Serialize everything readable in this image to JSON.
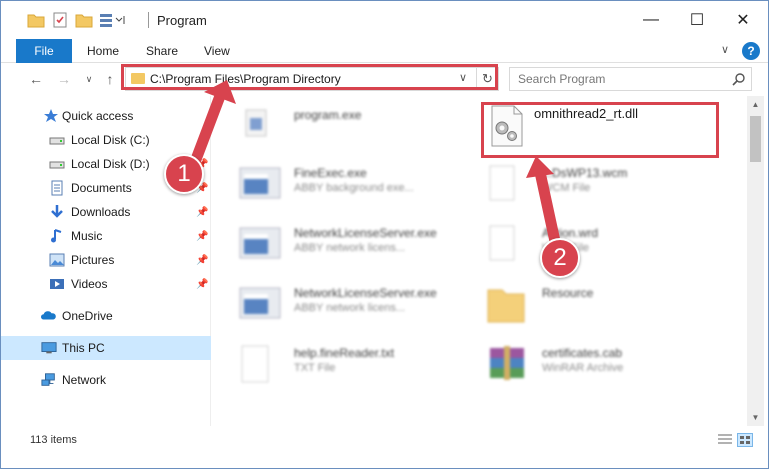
{
  "window": {
    "title": "Program",
    "controls": {
      "minimize": "—",
      "maximize": "☐",
      "close": "✕"
    }
  },
  "ribbon": {
    "tabs": [
      "File",
      "Home",
      "Share",
      "View"
    ],
    "help": "?"
  },
  "address": {
    "path": "C:\\Program Files\\Program Directory",
    "search_placeholder": "Search Program"
  },
  "nav_pane": {
    "items": [
      {
        "label": "Quick access",
        "icon": "star-icon",
        "pinned": false
      },
      {
        "label": "Local Disk (C:)",
        "icon": "drive-icon",
        "pinned": false
      },
      {
        "label": "Local Disk (D:)",
        "icon": "drive-icon",
        "pinned": true
      },
      {
        "label": "Documents",
        "icon": "documents-icon",
        "pinned": true
      },
      {
        "label": "Downloads",
        "icon": "downloads-icon",
        "pinned": true
      },
      {
        "label": "Music",
        "icon": "music-icon",
        "pinned": true
      },
      {
        "label": "Pictures",
        "icon": "pictures-icon",
        "pinned": true
      },
      {
        "label": "Videos",
        "icon": "videos-icon",
        "pinned": true
      },
      {
        "label": "OneDrive",
        "icon": "onedrive-icon",
        "pinned": false
      },
      {
        "label": "This PC",
        "icon": "this-pc-icon",
        "pinned": false,
        "selected": true
      },
      {
        "label": "Network",
        "icon": "network-icon",
        "pinned": false
      }
    ]
  },
  "files": {
    "left": [
      {
        "name": "program.exe",
        "desc": "",
        "icon": "program-exe-icon"
      },
      {
        "name": "FineExec.exe",
        "desc": "ABBY background exe...",
        "icon": "app-icon"
      },
      {
        "name": "NetworkLicenseServer.exe",
        "desc": "ABBY network licens...",
        "icon": "app-icon"
      },
      {
        "name": "NetworkLicenseServer.exe",
        "desc": "ABBY network licens...",
        "icon": "app-icon"
      },
      {
        "name": "help.fineReader.txt",
        "desc": "TXT File",
        "icon": "text-file-icon"
      }
    ],
    "right": [
      {
        "name": "omnithread2_rt.dll",
        "desc": "",
        "icon": "dll-gear-icon",
        "highlighted": true
      },
      {
        "name": "...DsWP13.wcm",
        "desc": "WCM File",
        "icon": "blank-file-icon"
      },
      {
        "name": "Action.wrd",
        "desc": "WRD File",
        "icon": "blank-file-icon"
      },
      {
        "name": "Resource",
        "desc": "",
        "icon": "folder-icon"
      },
      {
        "name": "certificates.cab",
        "desc": "WinRAR Archive",
        "icon": "winrar-icon"
      }
    ]
  },
  "status": {
    "item_count": "113 items"
  },
  "callouts": {
    "one": "1",
    "two": "2"
  },
  "colors": {
    "accent": "#1979ca",
    "highlight": "#d8434e",
    "selected": "#cce8ff"
  }
}
